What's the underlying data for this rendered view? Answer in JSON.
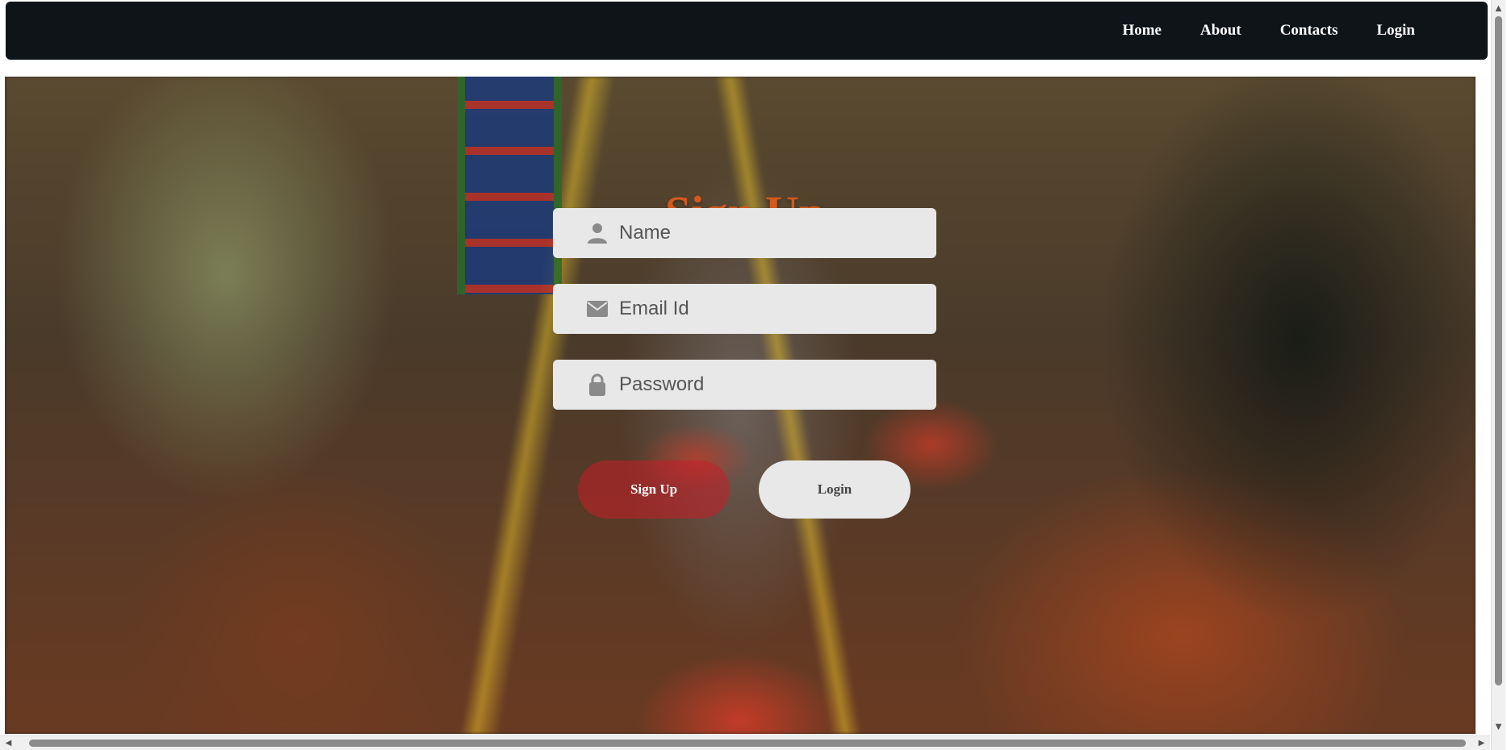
{
  "nav": {
    "links": [
      "Home",
      "About",
      "Contacts",
      "Login"
    ]
  },
  "form": {
    "title": "Sign Up",
    "name_placeholder": "Name",
    "email_placeholder": "Email Id",
    "password_placeholder": "Password",
    "signup_label": "Sign Up",
    "login_label": "Login"
  },
  "icons": {
    "name": "user-icon",
    "email": "envelope-icon",
    "password": "lock-icon"
  },
  "colors": {
    "navbar": "#0f1419",
    "title": "#d4591c",
    "signup_button": "#c81e28",
    "field_bg": "#e8e8e8"
  }
}
